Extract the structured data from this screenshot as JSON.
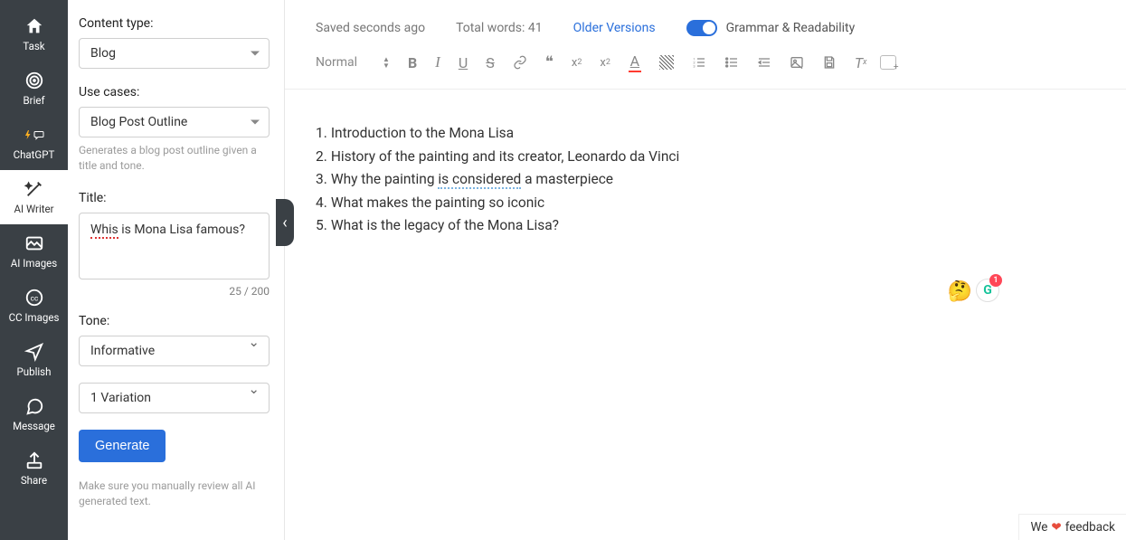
{
  "rail": [
    {
      "label": "Task"
    },
    {
      "label": "Brief"
    },
    {
      "label": "ChatGPT"
    },
    {
      "label": "AI Writer"
    },
    {
      "label": "AI Images"
    },
    {
      "label": "CC Images"
    },
    {
      "label": "Publish"
    },
    {
      "label": "Message"
    },
    {
      "label": "Share"
    }
  ],
  "sidebar": {
    "content_type_label": "Content type:",
    "content_type_value": "Blog",
    "use_cases_label": "Use cases:",
    "use_cases_value": "Blog Post Outline",
    "use_cases_helper": "Generates a blog post outline given a title and tone.",
    "title_label": "Title:",
    "title_value_misspelled": "Whis",
    "title_value_rest": " is Mona Lisa famous?",
    "title_counter": "25 / 200",
    "tone_label": "Tone:",
    "tone_value": "Informative",
    "variation_value": "1 Variation",
    "generate_label": "Generate",
    "disclaimer": "Make sure you manually review all AI generated text."
  },
  "collapse_glyph": "‹",
  "topbar": {
    "saved": "Saved seconds ago",
    "words": "Total words: 41",
    "older": "Older Versions",
    "grammar": "Grammar & Readability"
  },
  "toolbar": {
    "paragraph": "Normal",
    "bold": "B",
    "italic": "I",
    "underline": "U",
    "strike": "S",
    "quote": "❝",
    "sub": "x",
    "sup": "x",
    "font_color": "A",
    "clear": "T"
  },
  "document": {
    "lines": [
      "Introduction to the Mona Lisa",
      "History of the painting and its creator, Leonardo da Vinci",
      "Why the painting is considered a masterpiece",
      "What makes the painting so iconic",
      "What is the legacy of the Mona Lisa?"
    ],
    "line3_pre": "Why the painting ",
    "line3_mid": "is considered",
    "line3_post": " a masterpiece"
  },
  "float": {
    "emoji": "🤔",
    "badge_letter": "G",
    "badge_count": "1"
  },
  "feedback": {
    "pre": "We ",
    "heart": "❤",
    "post": " feedback"
  }
}
